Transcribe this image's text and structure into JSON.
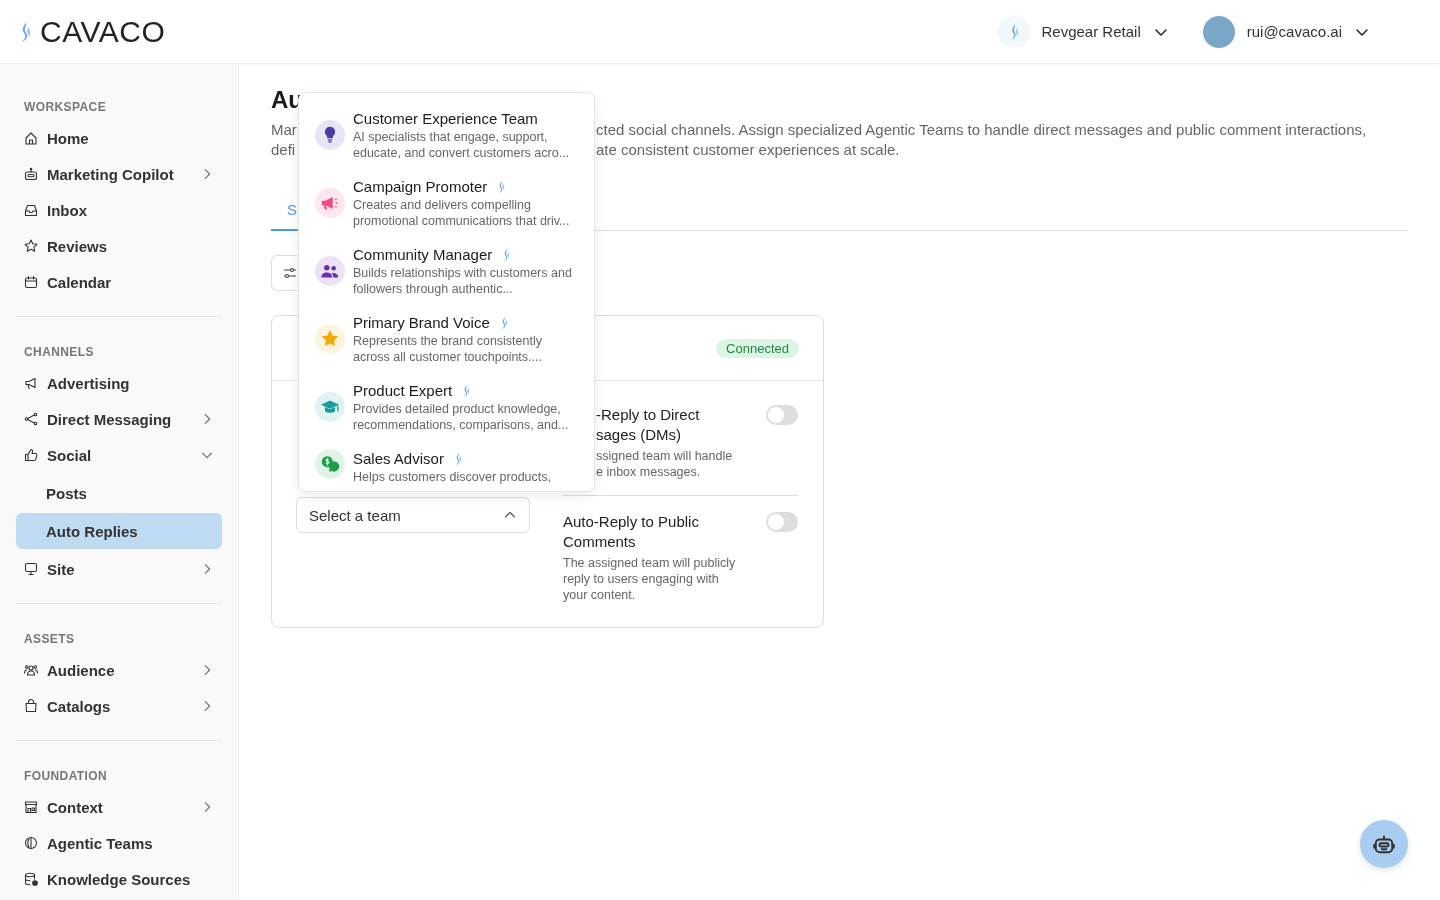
{
  "header": {
    "logo": "CAVACO",
    "workspace": "Revgear Retail",
    "user": "rui@cavaco.ai"
  },
  "sidebar": {
    "sections": [
      {
        "title": "WORKSPACE",
        "items": [
          {
            "label": "Home",
            "kind": "link",
            "selected": false
          },
          {
            "label": "Marketing Copilot",
            "kind": "menu",
            "expanded": false,
            "selected": false
          },
          {
            "label": "Inbox",
            "kind": "link",
            "selected": false
          },
          {
            "label": "Reviews",
            "kind": "link",
            "selected": false
          },
          {
            "label": "Calendar",
            "kind": "link",
            "selected": false
          }
        ]
      },
      {
        "title": "CHANNELS",
        "items": [
          {
            "label": "Advertising",
            "kind": "link",
            "selected": false
          },
          {
            "label": "Direct Messaging",
            "kind": "menu",
            "expanded": false,
            "selected": false
          },
          {
            "label": "Social",
            "kind": "menu",
            "expanded": true,
            "selected": false,
            "children": [
              {
                "label": "Posts",
                "selected": false
              },
              {
                "label": "Auto Replies",
                "selected": true
              }
            ]
          },
          {
            "label": "Site",
            "kind": "menu",
            "expanded": false,
            "selected": false
          }
        ]
      },
      {
        "title": "ASSETS",
        "items": [
          {
            "label": "Audience",
            "kind": "menu",
            "expanded": false,
            "selected": false
          },
          {
            "label": "Catalogs",
            "kind": "menu",
            "expanded": false,
            "selected": false
          }
        ]
      },
      {
        "title": "FOUNDATION",
        "items": [
          {
            "label": "Context",
            "kind": "menu",
            "expanded": false,
            "selected": false
          },
          {
            "label": "Agentic Teams",
            "kind": "link",
            "selected": false
          },
          {
            "label": "Knowledge Sources",
            "kind": "link",
            "selected": false
          }
        ]
      }
    ]
  },
  "page": {
    "title": "Au",
    "description_lines": [
      {
        "left": "Mar",
        "right": "cted social channels. Assign specialized Agentic Teams to handle direct messages and public comment interactions,"
      },
      {
        "left": "defi",
        "right": "ate consistent customer experiences at scale."
      }
    ],
    "tabs": [
      {
        "label": "S",
        "selected": true
      }
    ],
    "card": {
      "status": "Connected",
      "team_select": {
        "placeholder": "Select a team",
        "expanded": true
      },
      "settings": [
        {
          "title_lines": [
            "-Reply to Direct",
            "sages (DMs)"
          ],
          "description_lines": [
            "ssigned team will handle",
            "e inbox messages."
          ],
          "cut": true,
          "on": false
        },
        {
          "title_lines": [
            "Auto-Reply to Public",
            "Comments"
          ],
          "description_lines": [
            "The assigned team will publicly",
            "reply to users engaging with",
            "your content."
          ],
          "cut": false,
          "on": false
        }
      ]
    }
  },
  "team_menu": [
    {
      "name": "Customer Experience Team",
      "description_lines": [
        "AI specialists that engage, support,",
        "educate, and convert customers acro..."
      ],
      "kind": "bulb",
      "color": "#4c3aa8",
      "featured": false
    },
    {
      "name": "Campaign Promoter",
      "description_lines": [
        "Creates and delivers compelling",
        "promotional communications that driv..."
      ],
      "kind": "megaphone",
      "color": "#f04a86",
      "featured": true
    },
    {
      "name": "Community Manager",
      "description_lines": [
        "Builds relationships with customers and",
        "followers through authentic..."
      ],
      "kind": "people",
      "color": "#6a2fb5",
      "featured": true
    },
    {
      "name": "Primary Brand Voice",
      "description_lines": [
        "Represents the brand consistently",
        "across all customer touchpoints...."
      ],
      "kind": "star",
      "color": "#f2a900",
      "featured": true
    },
    {
      "name": "Product Expert",
      "description_lines": [
        "Provides detailed product knowledge,",
        "recommendations, comparisons, and..."
      ],
      "kind": "cap",
      "color": "#1a9a9a",
      "featured": true
    },
    {
      "name": "Sales Advisor",
      "description_lines": [
        "Helps customers discover products,"
      ],
      "kind": "money",
      "color": "#1f9e4a",
      "featured": true
    }
  ]
}
